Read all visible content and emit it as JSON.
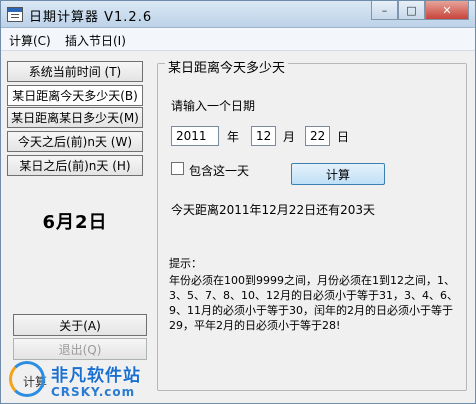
{
  "window": {
    "title": "日期计算器   V1.2.6",
    "controls": {
      "minimize": "–",
      "maximize": "□",
      "close": "✕"
    }
  },
  "menu": [
    {
      "label": "计算(C)"
    },
    {
      "label": "插入节日(I)"
    }
  ],
  "sidebar": {
    "items": [
      {
        "label": "系统当前时间    (T)",
        "active": false
      },
      {
        "label": "某日距离今天多少天(B)",
        "active": true
      },
      {
        "label": "某日距离某日多少天(M)",
        "active": false
      },
      {
        "label": "今天之后(前)n天  (W)",
        "active": false
      },
      {
        "label": "某日之后(前)n天  (H)",
        "active": false
      }
    ],
    "today": "6月2日",
    "about_label": "关于(A)",
    "exit_label": "退出(Q)"
  },
  "group": {
    "title": "某日距离今天多少天",
    "prompt": "请输入一个日期",
    "year": "2011",
    "year_unit": "年",
    "month": "12",
    "month_unit": "月",
    "day": "22",
    "day_unit": "日",
    "include_label": "包含这一天",
    "include_checked": false,
    "calc_label": "计算",
    "result": "今天距离2011年12月22日还有203天",
    "tips_title": "提示：",
    "tips_body": "年份必须在100到9999之间，月份必须在1到12之间，1、3、5、7、8、10、12月的日必须小于等于31，3、4、6、9、11月的必须小于等于30，闰年的2月的日必须小于等于29，平年2月的日必须小于等于28!"
  },
  "status": {
    "text": "计算"
  },
  "watermark": {
    "text": "非凡软件站",
    "sub": "CRSKY.com"
  },
  "colors": {
    "accent": "#3c7fb1",
    "window_bg": "#f0f0f0",
    "title_bg": "#bcd2e8"
  }
}
